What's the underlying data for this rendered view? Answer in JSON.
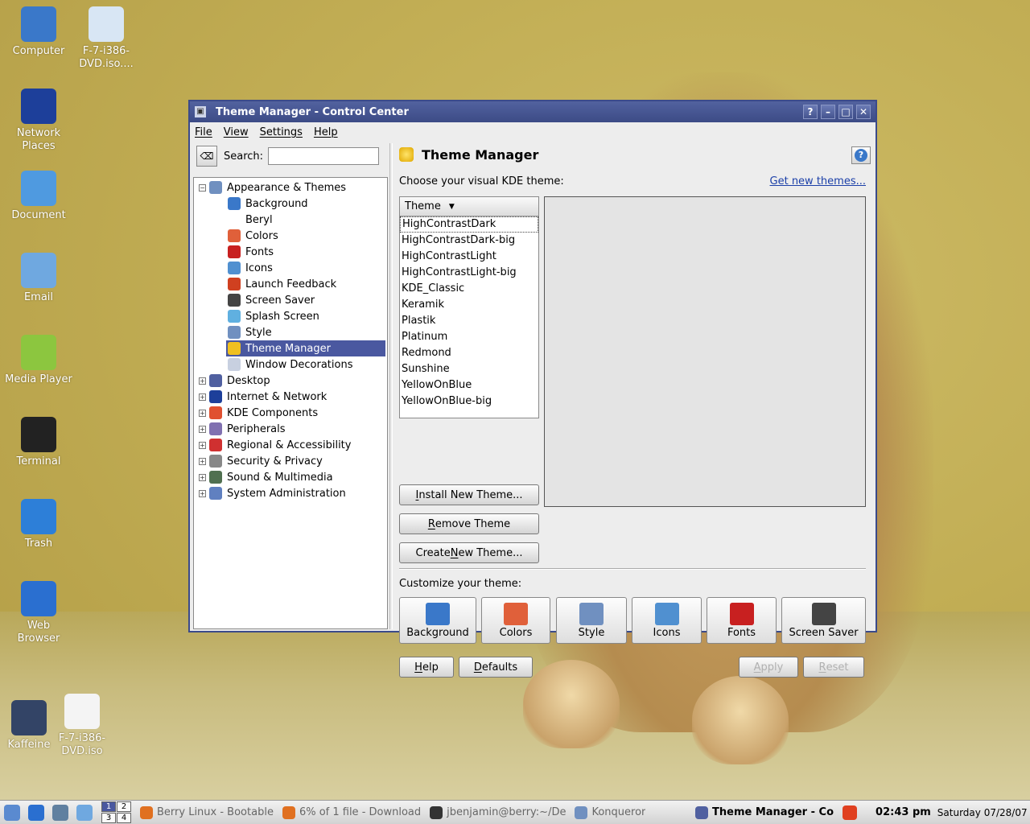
{
  "desktop": {
    "icons": [
      {
        "label": "Computer",
        "icon": "computer-icon",
        "color": "#3a78c9"
      },
      {
        "label": "F-7-i386-DVD.iso....",
        "icon": "text-file-icon",
        "color": "#d8e6f4"
      },
      {
        "label": "Network Places",
        "icon": "globe-icon",
        "color": "#1d3f9a"
      },
      {
        "label": "Document",
        "icon": "documents-folder-icon",
        "color": "#4f9ae0"
      },
      {
        "label": "Email",
        "icon": "email-icon",
        "color": "#6fa8e0"
      },
      {
        "label": "Media Player",
        "icon": "media-player-icon",
        "color": "#8cc63f"
      },
      {
        "label": "Terminal",
        "icon": "terminal-icon",
        "color": "#222222"
      },
      {
        "label": "Trash",
        "icon": "trash-icon",
        "color": "#2d7fd8"
      },
      {
        "label": "Web Browser",
        "icon": "web-browser-icon",
        "color": "#2a6fd0"
      },
      {
        "label": "Kaffeine",
        "icon": "kaffeine-icon",
        "color": "#334466"
      },
      {
        "label": "F-7-i386-DVD.iso",
        "icon": "dvd-file-icon",
        "color": "#f4f4f4"
      }
    ]
  },
  "window": {
    "title": "Theme Manager - Control Center",
    "controls": {
      "help": "?",
      "minimize": "–",
      "maximize": "□",
      "close": "✕"
    }
  },
  "menubar": {
    "items": [
      "File",
      "View",
      "Settings",
      "Help"
    ]
  },
  "search": {
    "label": "Search:",
    "value": "",
    "clear_icon": "clear-search-icon"
  },
  "tree": {
    "appearance": {
      "label": "Appearance & Themes",
      "expander": "−",
      "children": [
        {
          "label": "Background",
          "icon": "background-icon",
          "color": "#3a78c9"
        },
        {
          "label": "Beryl",
          "icon": "",
          "color": ""
        },
        {
          "label": "Colors",
          "icon": "colors-icon",
          "color": "#e0603a"
        },
        {
          "label": "Fonts",
          "icon": "fonts-icon",
          "color": "#c82020"
        },
        {
          "label": "Icons",
          "icon": "icons-icon",
          "color": "#5090d0"
        },
        {
          "label": "Launch Feedback",
          "icon": "rocket-icon",
          "color": "#d04020"
        },
        {
          "label": "Screen Saver",
          "icon": "screen-saver-icon",
          "color": "#444444"
        },
        {
          "label": "Splash Screen",
          "icon": "splash-icon",
          "color": "#60b0e0"
        },
        {
          "label": "Style",
          "icon": "style-icon",
          "color": "#7090c0"
        },
        {
          "label": "Theme Manager",
          "icon": "theme-manager-icon",
          "color": "#f0c020",
          "selected": true
        },
        {
          "label": "Window Decorations",
          "icon": "window-decorations-icon",
          "color": "#c8d0e0"
        }
      ]
    },
    "categories": [
      {
        "label": "Desktop",
        "icon": "desktop-icon",
        "color": "#5060a0"
      },
      {
        "label": "Internet & Network",
        "icon": "globe-icon",
        "color": "#1d3f9a"
      },
      {
        "label": "KDE Components",
        "icon": "kde-components-icon",
        "color": "#e05030"
      },
      {
        "label": "Peripherals",
        "icon": "peripherals-icon",
        "color": "#8070b0"
      },
      {
        "label": "Regional & Accessibility",
        "icon": "regional-icon",
        "color": "#d03030"
      },
      {
        "label": "Security & Privacy",
        "icon": "security-icon",
        "color": "#888888"
      },
      {
        "label": "Sound & Multimedia",
        "icon": "sound-icon",
        "color": "#507050"
      },
      {
        "label": "System Administration",
        "icon": "system-admin-icon",
        "color": "#6080c0"
      }
    ],
    "collapsed_expander": "+"
  },
  "module": {
    "title": "Theme Manager",
    "help_glyph": "?",
    "choose_label": "Choose your visual KDE theme:",
    "get_new_link": "Get new themes...",
    "list_header": "Theme",
    "themes": [
      "HighContrastDark",
      "HighContrastDark-big",
      "HighContrastLight",
      "HighContrastLight-big",
      "KDE_Classic",
      "Keramik",
      "Plastik",
      "Platinum",
      "Redmond",
      "Sunshine",
      "YellowOnBlue",
      "YellowOnBlue-big"
    ],
    "install_button": {
      "pre": "",
      "u": "I",
      "post": "nstall New Theme..."
    },
    "remove_button": {
      "pre": "",
      "u": "R",
      "post": "emove Theme"
    },
    "create_button": {
      "pre": "Create ",
      "u": "N",
      "post": "ew Theme..."
    },
    "customize_label": "Customize your theme:",
    "customize_buttons": [
      {
        "label": "Background",
        "icon": "background-icon",
        "color": "#3a78c9"
      },
      {
        "label": "Colors",
        "icon": "colors-icon",
        "color": "#e0603a"
      },
      {
        "label": "Style",
        "icon": "style-icon",
        "color": "#7090c0"
      },
      {
        "label": "Icons",
        "icon": "icons-icon",
        "color": "#5090d0"
      },
      {
        "label": "Fonts",
        "icon": "fonts-icon",
        "color": "#c82020"
      },
      {
        "label": "Screen Saver",
        "icon": "screen-saver-icon",
        "color": "#444444"
      }
    ],
    "help_button": {
      "u": "H",
      "post": "elp"
    },
    "defaults_button": {
      "u": "D",
      "post": "efaults"
    },
    "apply_button": {
      "u": "A",
      "post": "pply"
    },
    "reset_button": {
      "u": "R",
      "post": "eset"
    }
  },
  "taskbar": {
    "launchers": [
      {
        "icon": "kde-menu-icon",
        "color": "#5a8ad0"
      },
      {
        "icon": "web-browser-icon",
        "color": "#2a6fd0"
      },
      {
        "icon": "home-icon",
        "color": "#6080a0"
      },
      {
        "icon": "email-icon",
        "color": "#6fa8e0"
      }
    ],
    "pager": [
      "1",
      "2",
      "3",
      "4"
    ],
    "active_desktop": "1",
    "tasks": [
      {
        "label": "Berry Linux - Bootable",
        "icon": "firefox-icon",
        "color": "#e07020"
      },
      {
        "label": "6% of 1 file - Download",
        "icon": "firefox-icon",
        "color": "#e07020"
      },
      {
        "label": "jbenjamin@berry:~/De",
        "icon": "terminal-icon",
        "color": "#333333"
      },
      {
        "label": "Konqueror",
        "icon": "konqueror-icon",
        "color": "#7090c0"
      }
    ],
    "active_task": {
      "label": "Theme Manager - Co",
      "icon": "control-center-icon",
      "color": "#5060a0"
    },
    "tray_icon": {
      "icon": "tray-clipboard-icon",
      "color": "#e04020"
    },
    "time": "02:43 pm",
    "date": "Saturday  07/28/07"
  }
}
